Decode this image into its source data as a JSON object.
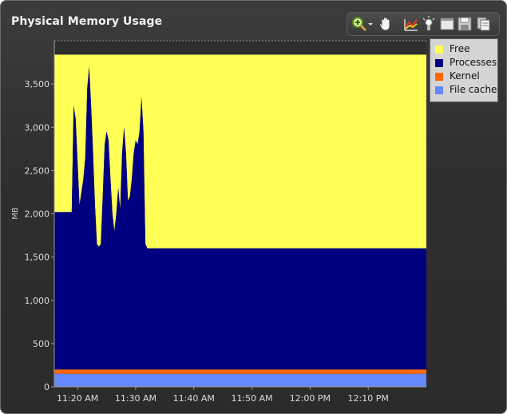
{
  "window": {
    "title": "Physical Memory Usage"
  },
  "toolbar": {
    "icons": [
      "zoom-icon",
      "chevron-down-icon",
      "pan-hand-icon",
      "chart-type-icon",
      "highlight-icon",
      "window-icon",
      "save-icon",
      "copy-icon"
    ]
  },
  "colors": {
    "free": "#ffff55",
    "processes": "#000080",
    "kernel": "#ff6600",
    "file_cache": "#6688ff"
  },
  "chart_data": {
    "type": "area",
    "title": "Physical Memory Usage",
    "ylabel": "MB",
    "xlabel": "",
    "ylim": [
      0,
      4000
    ],
    "yticks": [
      0,
      500,
      1000,
      1500,
      2000,
      2500,
      3000,
      3500
    ],
    "ytick_labels": [
      "0",
      "500",
      "1,000",
      "1,500",
      "2,000",
      "2,500",
      "3,000",
      "3,500"
    ],
    "xticks": [
      "11:20 AM",
      "11:30 AM",
      "11:40 AM",
      "11:50 AM",
      "12:00 PM",
      "12:10 PM"
    ],
    "legend": [
      "Free",
      "Processes",
      "Kernel",
      "File cache"
    ],
    "legend_position": "right",
    "stacking": "stacked",
    "total_memory": 3840,
    "kernel": 50,
    "file_cache": 150,
    "processes_series": {
      "x": [
        "11:19:00",
        "11:19:20",
        "11:19:40",
        "11:20:00",
        "11:20:20",
        "11:20:40",
        "11:21:00",
        "11:21:20",
        "11:21:40",
        "11:22:00",
        "11:22:20",
        "11:22:40",
        "11:23:00",
        "11:23:20",
        "11:23:40",
        "11:24:00",
        "11:24:20",
        "11:24:40",
        "11:25:00",
        "11:25:20",
        "11:25:40",
        "11:26:00",
        "11:26:20",
        "11:26:40",
        "11:27:00",
        "11:27:20",
        "11:27:40",
        "11:28:00",
        "11:28:20",
        "11:28:40",
        "11:29:00",
        "11:29:20",
        "11:29:40",
        "11:30:00",
        "11:30:20",
        "11:30:40",
        "11:31:00",
        "11:31:20",
        "11:31:40",
        "11:32:00",
        "11:32:20",
        "11:32:40",
        "11:33:00",
        "11:33:20",
        "11:34:00",
        "12:20:00"
      ],
      "values": [
        1820,
        3050,
        2900,
        2400,
        1900,
        2050,
        2200,
        2450,
        3250,
        3500,
        3050,
        2500,
        1900,
        1450,
        1420,
        1450,
        2000,
        2600,
        2750,
        2650,
        2200,
        1800,
        1600,
        1800,
        2100,
        1850,
        2500,
        2800,
        2500,
        1950,
        2000,
        2200,
        2500,
        2650,
        2600,
        2750,
        3150,
        2750,
        1450,
        1400,
        1400,
        1400,
        1400,
        1400,
        1400,
        1400
      ]
    }
  }
}
